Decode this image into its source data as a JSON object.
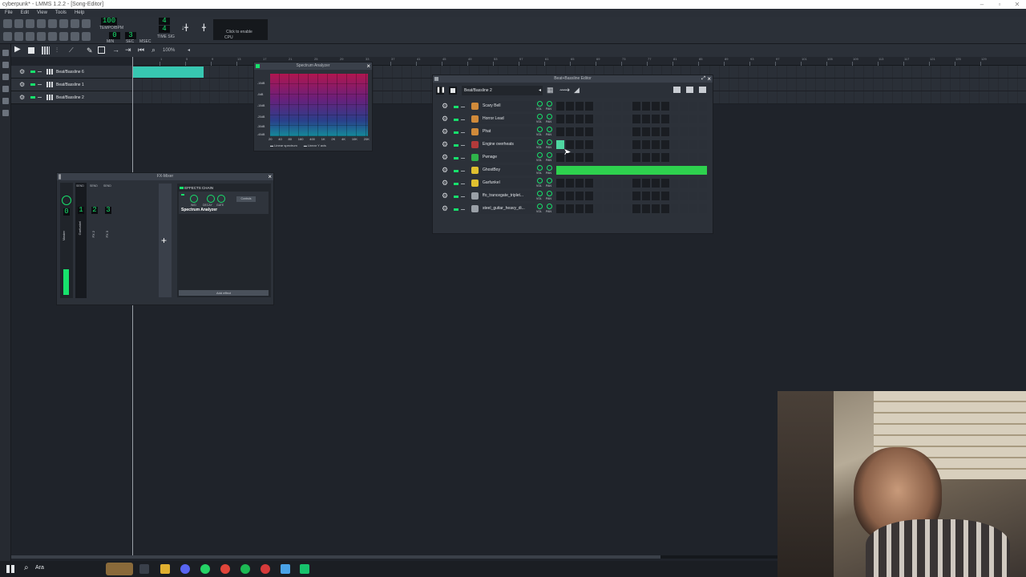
{
  "window_title": "cyberpunk* - LMMS 1.2.2 - [Song-Editor]",
  "menu": [
    "File",
    "Edit",
    "View",
    "Tools",
    "Help"
  ],
  "toolbar": {
    "tempo_value": "100",
    "tempo_label": "TEMPO/BPM",
    "time_min": "0",
    "time_sec": "3",
    "time_min_label": "MIN",
    "time_sec_label": "SEC",
    "time_msec_label": "MSEC",
    "time_sig_top": "4",
    "time_sig_bottom": "4",
    "time_sig_label": "TIME SIG",
    "cpu_hint": "Click to enable",
    "cpu_label": "CPU",
    "zoom": "100%"
  },
  "song_editor": {
    "tracks": [
      {
        "name": "Beat/Bassline 6"
      },
      {
        "name": "Beat/Bassline 1"
      },
      {
        "name": "Beat/Bassline 2"
      }
    ],
    "ruler_ticks": [
      "1",
      "5",
      "9",
      "13",
      "17",
      "21",
      "25",
      "29",
      "33",
      "37",
      "41",
      "45",
      "49",
      "53",
      "57",
      "61",
      "65",
      "69",
      "73",
      "77",
      "81",
      "85",
      "89",
      "93",
      "97",
      "101",
      "105",
      "109",
      "113",
      "117",
      "121",
      "125",
      "129"
    ]
  },
  "spectrum_analyzer": {
    "title": "Spectrum Analyzer",
    "db_labels": [
      "-10dB",
      "-0dB",
      "-10dB",
      "-20dB",
      "-30dB",
      "-40dB"
    ],
    "freq_labels": [
      "20",
      "40",
      "80",
      "160",
      "400",
      "1K",
      "2K",
      "4K",
      "10K",
      "20K"
    ],
    "opt_linear_spectrum": "Linear spectrum",
    "opt_linear_y": "Linear Y axis"
  },
  "fx_mixer": {
    "title": "FX-Mixer",
    "send_label": "SEND",
    "channels": [
      {
        "num": "0",
        "name": "Master"
      },
      {
        "num": "1",
        "name": "Garfunkel"
      },
      {
        "num": "2",
        "name": "FX 2"
      },
      {
        "num": "3",
        "name": "FX 3"
      }
    ],
    "add_label": "+",
    "effects_chain_label": "EFFECTS CHAIN",
    "effect_name": "Spectrum Analyzer",
    "knob_wd": "W/D",
    "knob_decay": "DECAY",
    "knob_gate": "GATE",
    "controls_btn": "Controls",
    "add_effect_btn": "Add effect"
  },
  "bb_editor": {
    "title": "Beat+Bassline Editor",
    "pattern_select": "Beat/Bassline 2",
    "vol_label": "VOL",
    "pan_label": "PAN",
    "instruments": [
      {
        "name": "Scary Bell",
        "color": "#d08a3a"
      },
      {
        "name": "Horror Lead",
        "color": "#d08a3a"
      },
      {
        "name": "Phat",
        "color": "#d08a3a"
      },
      {
        "name": "Engine overheats",
        "color": "#b33a3a"
      },
      {
        "name": "Pwnage",
        "color": "#2fb34a"
      },
      {
        "name": "GhostBoy",
        "color": "#e0c030"
      },
      {
        "name": "Garfunkel",
        "color": "#e0c030"
      },
      {
        "name": "ffo_trancegate_triplet...",
        "color": "#9aa0a7"
      },
      {
        "name": "steel_guitar_heavy_di...",
        "color": "#9aa0a7"
      }
    ],
    "active_step": {
      "row": 3,
      "step": 0
    },
    "pattern_row": 5,
    "pattern_color": "#2ed14e"
  },
  "taskbar": {
    "search_placeholder": "Ara"
  }
}
